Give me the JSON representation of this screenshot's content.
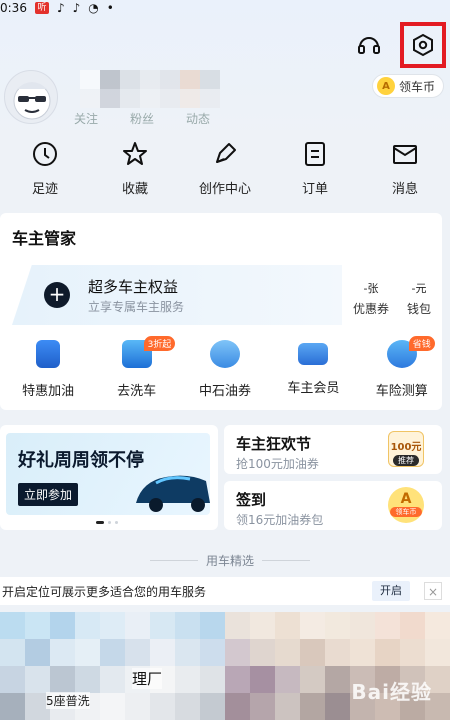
{
  "status_bar": {
    "time": "0:36",
    "app_badge": "听",
    "other_icons": [
      "tiktok-icon",
      "tiktok-icon",
      "snapchat-icon",
      "dot-icon"
    ]
  },
  "header": {
    "icons": [
      "headset-icon",
      "settings-icon"
    ],
    "highlight_color": "#e31b23"
  },
  "profile": {
    "follow_labels": [
      "关注",
      "粉丝",
      "动态"
    ],
    "coin_pill": "领车币"
  },
  "quick_menu": [
    {
      "label": "足迹",
      "icon": "clock-icon"
    },
    {
      "label": "收藏",
      "icon": "star-icon"
    },
    {
      "label": "创作中心",
      "icon": "pen-icon"
    },
    {
      "label": "订单",
      "icon": "order-icon"
    },
    {
      "label": "消息",
      "icon": "mail-icon"
    }
  ],
  "owner_section": {
    "title": "车主管家",
    "benefit_title": "超多车主权益",
    "benefit_subtitle": "立享专属车主服务",
    "stats": [
      {
        "top": "-张",
        "bottom": "优惠券"
      },
      {
        "top": "-元",
        "bottom": "钱包"
      }
    ],
    "services": [
      {
        "label": "特惠加油",
        "icon": "fuel-icon",
        "badge": ""
      },
      {
        "label": "去洗车",
        "icon": "carwash-icon",
        "badge": "3折起"
      },
      {
        "label": "中石油券",
        "icon": "coupon-icon",
        "badge": ""
      },
      {
        "label": "车主会员",
        "icon": "vip-card-icon",
        "badge": ""
      },
      {
        "label": "车险测算",
        "icon": "insurance-icon",
        "badge": "省钱"
      }
    ]
  },
  "promo": {
    "title": "好礼周周领不停",
    "button": "立即参加"
  },
  "right_cards": [
    {
      "title": "车主狂欢节",
      "subtitle": "抢100元加油券",
      "icon_text": "100元",
      "icon_sub": "推荐"
    },
    {
      "title": "签到",
      "subtitle": "领16元加油券包",
      "icon_text": "A",
      "icon_sub": "领车币"
    }
  ],
  "divider": {
    "label": "用车精选"
  },
  "location_bar": {
    "text": "开启定位可展示更多适合您的用车服务",
    "button": "开启",
    "close": "×"
  },
  "listing": {
    "name": "理厂",
    "subtitle": "5座普洗"
  },
  "watermark": "Bai经验"
}
